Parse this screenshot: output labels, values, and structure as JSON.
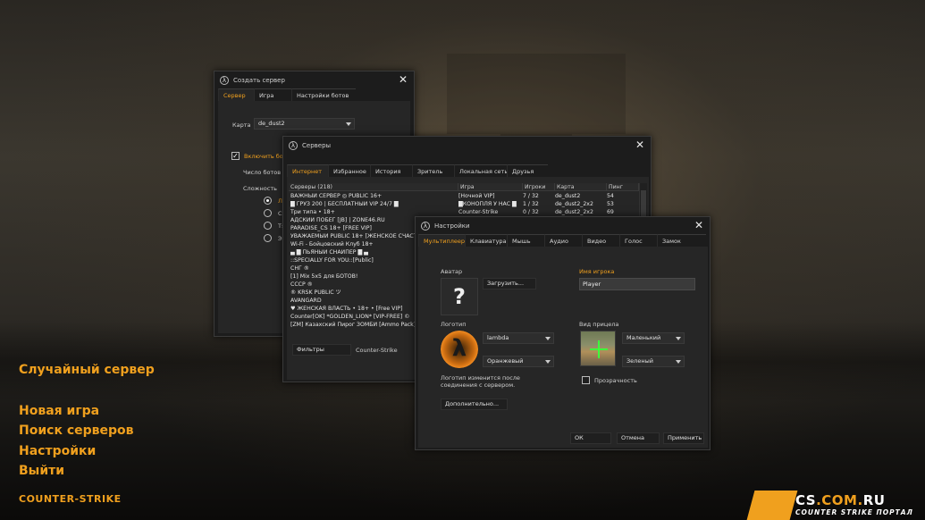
{
  "main_menu": {
    "items": [
      "Случайный сервер",
      "Новая игра",
      "Поиск серверов",
      "Настройки",
      "Выйти"
    ],
    "logo_text": "COUNTER-STRIKE"
  },
  "create_server": {
    "title": "Создать сервер",
    "tabs": [
      "Сервер",
      "Игра",
      "Настройки ботов"
    ],
    "map_label": "Карта",
    "map_value": "de_dust2",
    "enable_bots_label": "Включить бот",
    "bot_count_label": "Число ботов",
    "difficulty_label": "Сложность",
    "difficulty_options": [
      "Л",
      "Ср",
      "Тя",
      "Эк"
    ]
  },
  "servers": {
    "title": "Серверы",
    "tabs": [
      "Интернет",
      "Избранное",
      "История",
      "Зритель",
      "Локальная сеть",
      "Друзья"
    ],
    "columns": [
      "Серверы (218)",
      "Игра",
      "Игроки",
      "Карта",
      "Пинг"
    ],
    "rows": [
      {
        "name": "ВАЖНЫЙ СЕРВЕР ◎ PUBLIC 16+",
        "game": "[Ночной VIP]",
        "players": "7 / 32",
        "map": "de_dust2",
        "ping": "54"
      },
      {
        "name": "█ ГРУЗ 200 | БЕСПЛАТНЫЙ VIP 24/7 █",
        "game": "█КОНОПЛЯ У НАС █",
        "players": "1 / 32",
        "map": "de_dust2_2x2",
        "ping": "53"
      },
      {
        "name": "Три типа • 18+",
        "game": "Counter-Strike",
        "players": "0 / 32",
        "map": "de_dust2_2x2",
        "ping": "69"
      },
      {
        "name": "АДСКИЙ ПОБЕГ [JB] | ZONE46.RU",
        "game": "",
        "players": "",
        "map": "",
        "ping": ""
      },
      {
        "name": "PARADISE_CS 18+ [FREE VIP]",
        "game": "",
        "players": "",
        "map": "",
        "ping": ""
      },
      {
        "name": "УВАЖАЕМЫЙ PUBLIC 18+ [ЖЕНСКОЕ СЧАСТ",
        "game": "",
        "players": "",
        "map": "",
        "ping": ""
      },
      {
        "name": "Wi-Fi - Бойцовский Клуб 18+",
        "game": "",
        "players": "",
        "map": "",
        "ping": ""
      },
      {
        "name": "▄ █ ПЬЯНЫЙ СНАЙПЕР █ ▄",
        "game": "",
        "players": "",
        "map": "",
        "ping": ""
      },
      {
        "name": "::SPECIALLY FOR YOU::[Public]",
        "game": "",
        "players": "",
        "map": "",
        "ping": ""
      },
      {
        "name": "СНГ ®",
        "game": "",
        "players": "",
        "map": "",
        "ping": ""
      },
      {
        "name": "[1] Mix 5x5 для БОТОВ!",
        "game": "",
        "players": "",
        "map": "",
        "ping": ""
      },
      {
        "name": "СССР ®",
        "game": "",
        "players": "",
        "map": "",
        "ping": ""
      },
      {
        "name": "® KRSK PUBLIC ツ",
        "game": "",
        "players": "",
        "map": "",
        "ping": ""
      },
      {
        "name": "AVANGARD",
        "game": "",
        "players": "",
        "map": "",
        "ping": ""
      },
      {
        "name": "♥ ЖЕНСКАЯ ВЛАСТЬ • 18+ • [Free VIP]",
        "game": "",
        "players": "",
        "map": "",
        "ping": ""
      },
      {
        "name": "Counter[OK] *GOLDEN_LION* [VIP-FREE] ©",
        "game": "",
        "players": "",
        "map": "",
        "ping": ""
      },
      {
        "name": "[ZM] Казахский Пирог ЗОМБИ [Ammo Pack]",
        "game": "",
        "players": "",
        "map": "",
        "ping": ""
      }
    ],
    "filters_label": "Фильтры",
    "filter_game": "Counter-Strike"
  },
  "settings": {
    "title": "Настройки",
    "tabs": [
      "Мультиплеер",
      "Клавиатура",
      "Мышь",
      "Аудио",
      "Видео",
      "Голос",
      "Замок"
    ],
    "avatar_label": "Аватар",
    "avatar_glyph": "?",
    "upload_button": "Загрузить...",
    "player_name_label": "Имя игрока",
    "player_name_value": "Player",
    "logo_label": "Логотип",
    "logo_glyph": "λ",
    "logo_select": "lambda",
    "logo_color_select": "Оранжевый",
    "logo_note": "Логотип изменится после соединения с сервером.",
    "crosshair_label": "Вид прицела",
    "crosshair_size_select": "Маленький",
    "crosshair_color_select": "Зеленый",
    "transparency_label": "Прозрачность",
    "advanced_button": "Дополнительно...",
    "ok_button": "ОК",
    "cancel_button": "Отмена",
    "apply_button": "Применить"
  },
  "watermark": {
    "site": "CS",
    "dot": ".COM.",
    "tld": "RU",
    "sub": "COUNTER STRIKE ПОРТАЛ"
  },
  "colors": {
    "accent": "#f0a01e",
    "window_bg": "#1c1c1c"
  }
}
